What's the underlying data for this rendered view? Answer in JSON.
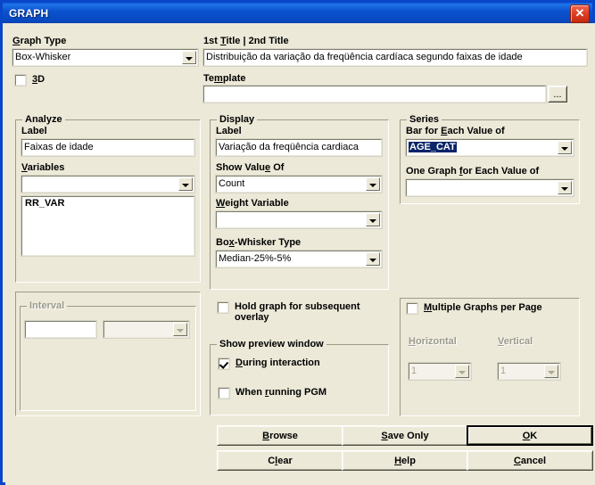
{
  "window": {
    "title": "GRAPH",
    "close_label": "✕"
  },
  "graph_type": {
    "label": "Graph Type",
    "label_accel": "G",
    "value": "Box-Whisker"
  },
  "three_d": {
    "label": "3D",
    "label_accel": "3",
    "checked": false
  },
  "titles": {
    "label": "1st Title | 2nd Title",
    "label_accel": "T",
    "value": "Distribuição da variação da freqüência cardíaca segundo faixas de idade"
  },
  "template": {
    "label": "Template",
    "label_accel": "m",
    "value": "",
    "browse_label": "..."
  },
  "analyze": {
    "group_title": "Analyze",
    "label_label": "Label",
    "label_value": "Faixas de idade",
    "variables_label": "Variables",
    "variables_accel": "V",
    "variables_value": "",
    "variables_list": [
      "RR_VAR"
    ]
  },
  "display": {
    "group_title": "Display",
    "label_label": "Label",
    "label_value": "Variação da freqüência cardiaca",
    "show_value_of_label": "Show Value Of",
    "show_value_of_accel": "e",
    "show_value_of_value": "Count",
    "weight_variable_label": "Weight Variable",
    "weight_variable_accel": "W",
    "weight_variable_value": "",
    "box_whisker_type_label": "Box-Whisker Type",
    "box_whisker_type_accel": "x",
    "box_whisker_type_value": "Median-25%-5%"
  },
  "series": {
    "group_title": "Series",
    "bar_label": "Bar for Each Value of",
    "bar_accel": "E",
    "bar_value": "AGE_CAT",
    "one_graph_label": "One Graph for Each Value of",
    "one_graph_accel": "f",
    "one_graph_value": ""
  },
  "interval": {
    "group_title": "Interval",
    "enabled": false,
    "value1": "",
    "value2": ""
  },
  "hold_graph": {
    "label_line1": "Hold graph for subsequent",
    "label_line2": "overlay",
    "accel": "u",
    "checked": false
  },
  "preview": {
    "group_title": "Show preview window",
    "during_interaction_label": "During interaction",
    "during_interaction_accel": "D",
    "during_interaction_checked": true,
    "when_running_label": "When running PGM",
    "when_running_accel": "r",
    "when_running_checked": false
  },
  "multiple_graphs": {
    "checkbox_label": "Multiple Graphs per Page",
    "checkbox_accel": "M",
    "checked": false,
    "horizontal_label": "Horizontal",
    "horizontal_accel": "H",
    "horizontal_value": "1",
    "vertical_label": "Vertical",
    "vertical_accel": "V",
    "vertical_value": "1"
  },
  "buttons": {
    "browse": "Browse",
    "browse_accel": "B",
    "clear": "Clear",
    "clear_accel": "l",
    "save_only": "Save Only",
    "save_only_accel": "S",
    "help": "Help",
    "help_accel": "H",
    "ok": "OK",
    "ok_accel": "O",
    "cancel": "Cancel",
    "cancel_accel": "C"
  },
  "colors": {
    "titlebar": "#0a52cf",
    "window_bg": "#ece9d8",
    "selection": "#0a246a",
    "frame": "#0a46c8",
    "close_button": "#c12a12"
  }
}
